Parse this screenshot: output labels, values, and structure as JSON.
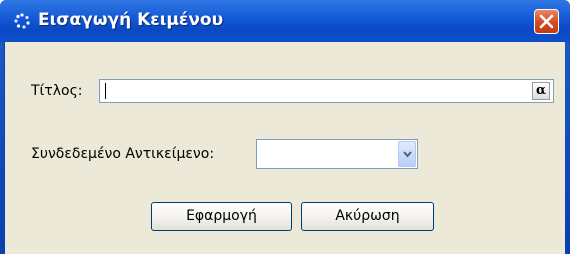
{
  "window": {
    "title": "Εισαγωγή Κειμένου",
    "title_icon": "dotted-circle-icon",
    "close_icon": "close-x-icon"
  },
  "form": {
    "title_label": "Τίτλος:",
    "title_value": "",
    "alpha_button_label": "α",
    "linked_object_label": "Συνδεδεμένο Αντικείμενο:",
    "linked_object_value": ""
  },
  "buttons": {
    "apply_label": "Εφαρμογή",
    "cancel_label": "Ακύρωση"
  },
  "colors": {
    "titlebar": "#0b49c4",
    "close_button": "#d44a22",
    "client_background": "#ece9d8",
    "input_border": "#7f9db9"
  }
}
